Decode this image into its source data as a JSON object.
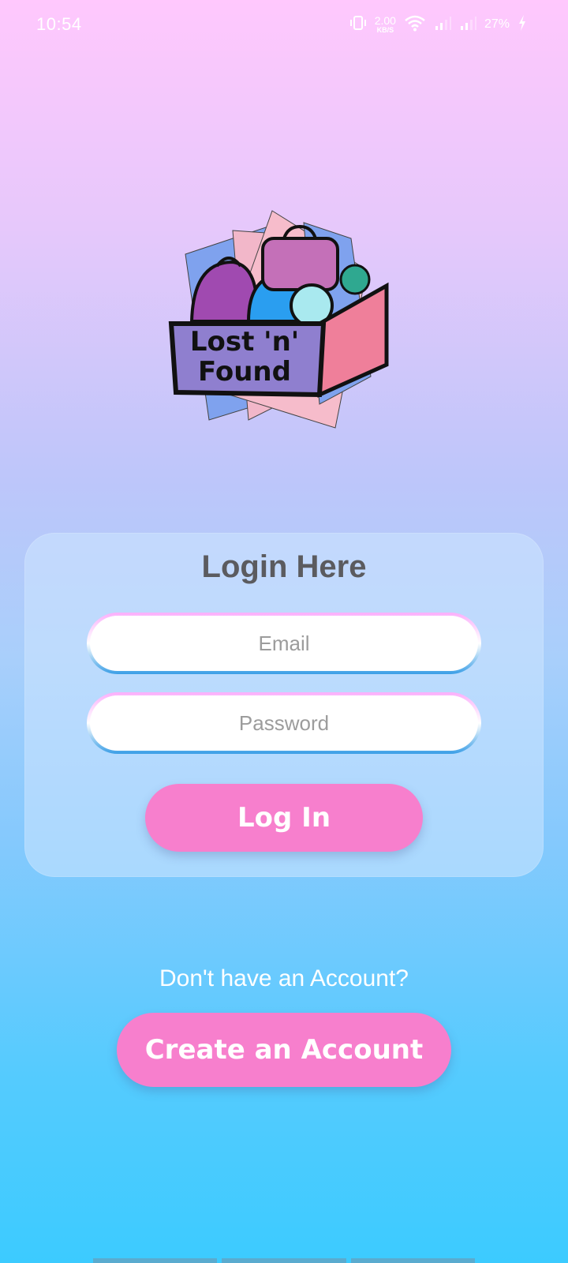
{
  "status_bar": {
    "time": "10:54",
    "net_speed": "2.00",
    "net_unit": "KB/S",
    "battery": "27%"
  },
  "logo": {
    "line1": "Lost 'n'",
    "line2": "Found"
  },
  "login": {
    "title": "Login Here",
    "email_placeholder": "Email",
    "password_placeholder": "Password",
    "login_button": "Log In"
  },
  "signup": {
    "prompt": "Don't have an Account?",
    "create_button": "Create an Account"
  },
  "colors": {
    "accent_pink": "#f77fcd",
    "title_gray": "#5b5b5f"
  }
}
